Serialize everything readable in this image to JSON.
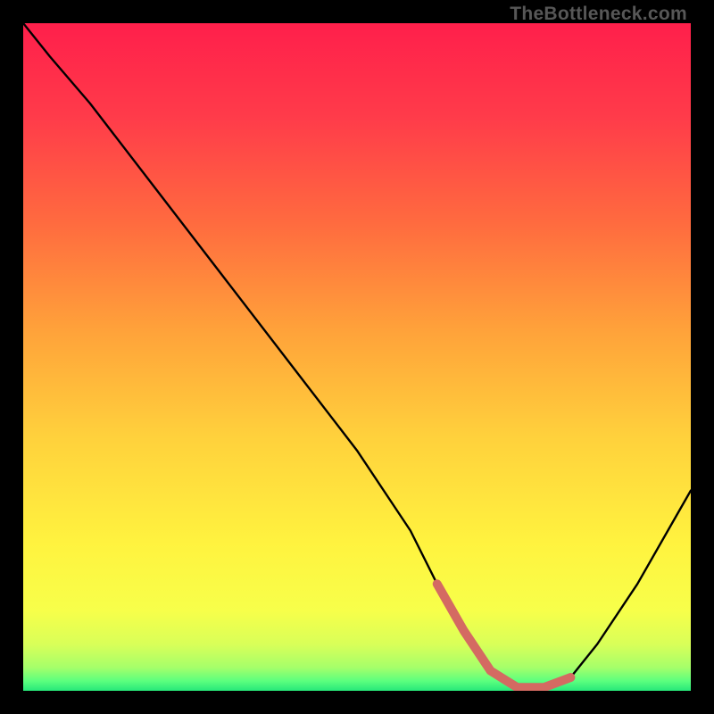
{
  "watermark": "TheBottleneck.com",
  "chart_data": {
    "type": "line",
    "title": "",
    "xlabel": "",
    "ylabel": "",
    "xlim": [
      0,
      100
    ],
    "ylim": [
      0,
      100
    ],
    "series": [
      {
        "name": "bottleneck-curve",
        "x": [
          0,
          4,
          10,
          20,
          30,
          40,
          50,
          58,
          62,
          66,
          70,
          74,
          78,
          82,
          86,
          92,
          100
        ],
        "values": [
          100,
          95,
          88,
          75,
          62,
          49,
          36,
          24,
          16,
          9,
          3,
          0.5,
          0.5,
          2,
          7,
          16,
          30
        ]
      }
    ],
    "highlight": {
      "name": "optimal-range",
      "x": [
        62,
        66,
        70,
        74,
        78,
        82
      ],
      "values": [
        16,
        9,
        3,
        0.5,
        0.5,
        2
      ],
      "color": "#d46a62"
    },
    "gradient_stops": [
      {
        "pos": 0.0,
        "color": "#ff1f4b"
      },
      {
        "pos": 0.14,
        "color": "#ff3b4a"
      },
      {
        "pos": 0.3,
        "color": "#ff6b3f"
      },
      {
        "pos": 0.46,
        "color": "#ffa23a"
      },
      {
        "pos": 0.62,
        "color": "#ffd13c"
      },
      {
        "pos": 0.78,
        "color": "#fff33f"
      },
      {
        "pos": 0.88,
        "color": "#f7ff4a"
      },
      {
        "pos": 0.93,
        "color": "#d9ff58"
      },
      {
        "pos": 0.965,
        "color": "#a6ff6a"
      },
      {
        "pos": 0.985,
        "color": "#5dff7e"
      },
      {
        "pos": 1.0,
        "color": "#27e87a"
      }
    ]
  }
}
